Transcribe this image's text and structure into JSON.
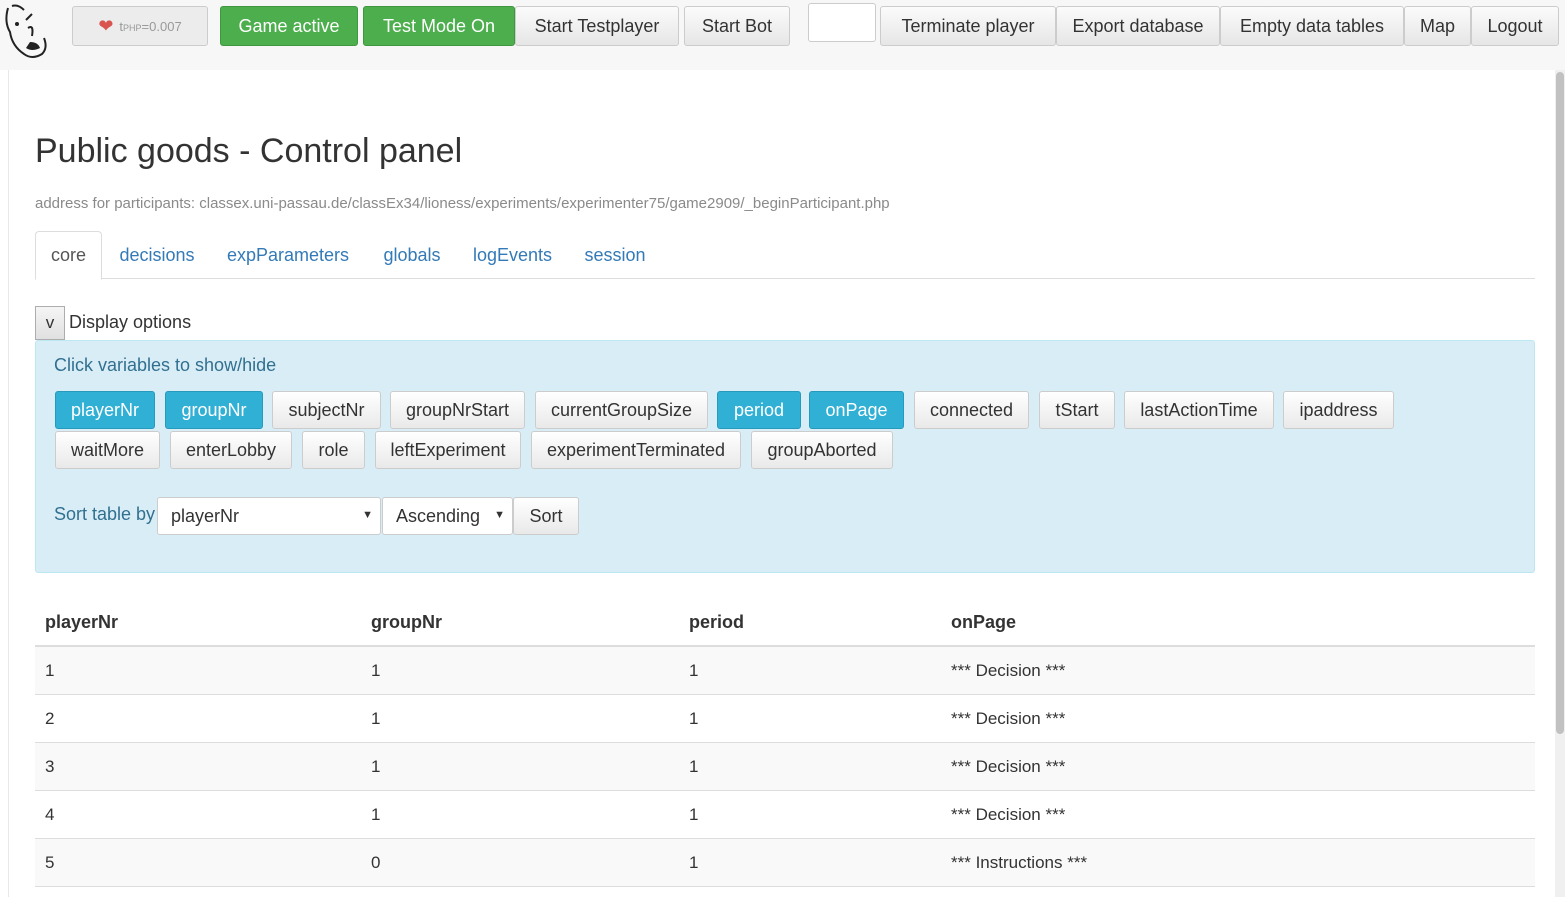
{
  "topbar": {
    "timing": "t",
    "timing_sub": "PHP",
    "timing_val": "=0.007",
    "buttons": {
      "game_active": "Game active",
      "test_mode": "Test Mode On",
      "start_testplayer": "Start Testplayer",
      "start_bot": "Start Bot",
      "terminate_player": "Terminate player",
      "export_database": "Export database",
      "empty_tables": "Empty data tables",
      "map": "Map",
      "logout": "Logout"
    },
    "player_input": ""
  },
  "colors": {
    "green": "#4cae4c",
    "info": "#31b0d5",
    "panel": "#d9edf7",
    "link": "#337ab7"
  },
  "page": {
    "title": "Public goods - Control panel",
    "address": "address for participants: classex.uni-passau.de/classEx34/lioness/experiments/experimenter75/game2909/_beginParticipant.php"
  },
  "tabs": [
    "core",
    "decisions",
    "expParameters",
    "globals",
    "logEvents",
    "session"
  ],
  "display": {
    "toggle": "v",
    "label": "Display options",
    "hint": "Click variables to show/hide",
    "variables": [
      {
        "label": "playerNr",
        "on": true
      },
      {
        "label": "groupNr",
        "on": true
      },
      {
        "label": "subjectNr",
        "on": false
      },
      {
        "label": "groupNrStart",
        "on": false
      },
      {
        "label": "currentGroupSize",
        "on": false
      },
      {
        "label": "period",
        "on": true
      },
      {
        "label": "onPage",
        "on": true
      },
      {
        "label": "connected",
        "on": false
      },
      {
        "label": "tStart",
        "on": false
      },
      {
        "label": "lastActionTime",
        "on": false
      },
      {
        "label": "ipaddress",
        "on": false
      },
      {
        "label": "waitMore",
        "on": false
      },
      {
        "label": "enterLobby",
        "on": false
      },
      {
        "label": "role",
        "on": false
      },
      {
        "label": "leftExperiment",
        "on": false
      },
      {
        "label": "experimentTerminated",
        "on": false
      },
      {
        "label": "groupAborted",
        "on": false
      }
    ],
    "sort_label": "Sort table by",
    "sort_field": "playerNr",
    "sort_order": "Ascending",
    "sort_button": "Sort"
  },
  "table": {
    "headers": [
      "playerNr",
      "groupNr",
      "period",
      "onPage"
    ],
    "rows": [
      [
        "1",
        "1",
        "1",
        "*** Decision ***"
      ],
      [
        "2",
        "1",
        "1",
        "*** Decision ***"
      ],
      [
        "3",
        "1",
        "1",
        "*** Decision ***"
      ],
      [
        "4",
        "1",
        "1",
        "*** Decision ***"
      ],
      [
        "5",
        "0",
        "1",
        "*** Instructions ***"
      ]
    ]
  }
}
